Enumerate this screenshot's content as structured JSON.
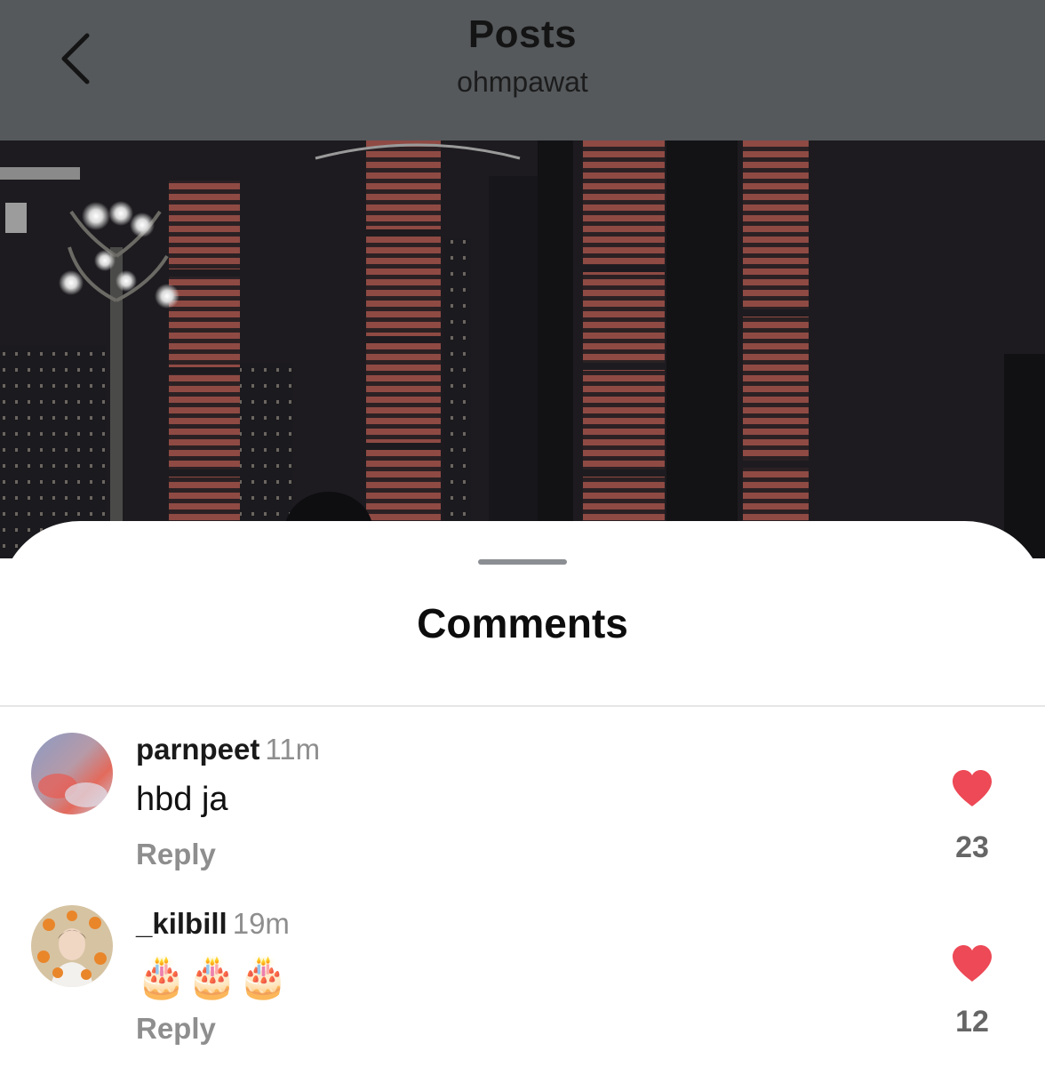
{
  "header": {
    "title": "Posts",
    "subtitle": "ohmpawat",
    "back_icon": "chevron-left-icon"
  },
  "sheet": {
    "title": "Comments"
  },
  "comments": [
    {
      "username": "parnpeet",
      "time": "11m",
      "text": "hbd ja",
      "reply_label": "Reply",
      "likes": "23",
      "liked": true
    },
    {
      "username": "_kilbill",
      "time": "19m",
      "text": "🎂🎂🎂",
      "reply_label": "Reply",
      "likes": "12",
      "liked": true
    }
  ],
  "colors": {
    "header_bg": "#55595c",
    "heart": "#ed4956",
    "muted_text": "#8e8e8e"
  }
}
